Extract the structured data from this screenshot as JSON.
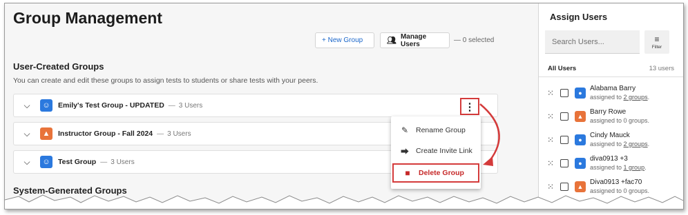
{
  "page": {
    "title": "Group Management",
    "new_group_label": "+ New Group",
    "manage_users_label": "Manage Users",
    "selected_text": "— 0 selected"
  },
  "user_groups": {
    "title": "User-Created Groups",
    "description": "You can create and edit these groups to assign tests to students or share tests with your peers.",
    "rows": [
      {
        "name": "Emily's Test Group - UPDATED",
        "count": "3 Users",
        "icon": "users-icon",
        "color": "#2b79de"
      },
      {
        "name": "Instructor Group - Fall 2024",
        "count": "3 Users",
        "icon": "graduation-cap-icon",
        "color": "#e8733a"
      },
      {
        "name": "Test Group",
        "count": "3 Users",
        "icon": "users-icon",
        "color": "#2b79de"
      }
    ]
  },
  "menu": {
    "items": [
      {
        "label": "Rename Group",
        "icon": "pencil-icon"
      },
      {
        "label": "Create Invite Link",
        "icon": "share-icon"
      },
      {
        "label": "Delete Group",
        "icon": "trash-icon",
        "color": "#c62828"
      }
    ]
  },
  "system_groups": {
    "title": "System-Generated Groups"
  },
  "assign": {
    "title": "Assign Users",
    "search_placeholder": "Search Users...",
    "filter_label": "Filter",
    "all_users_label": "All Users",
    "user_count": "13 users",
    "users": [
      {
        "name": "Alabama Barry",
        "prefix": "assigned to ",
        "link": "2 groups",
        "suffix": ".",
        "role": "student"
      },
      {
        "name": "Barry Rowe",
        "prefix": "assigned to 0 groups.",
        "link": "",
        "suffix": "",
        "role": "instructor"
      },
      {
        "name": "Cindy Mauck",
        "prefix": "assigned to ",
        "link": "2 groups",
        "suffix": ".",
        "role": "student"
      },
      {
        "name": "diva0913 +3",
        "prefix": "assigned to ",
        "link": "1 group",
        "suffix": ".",
        "role": "student"
      },
      {
        "name": "Diva0913 +fac70",
        "prefix": "assigned to 0 groups.",
        "link": "",
        "suffix": "",
        "role": "instructor"
      }
    ]
  },
  "colors": {
    "accent_blue": "#1a66c9",
    "highlight_red": "#d43a3a",
    "student_icon": "#2b79de",
    "instructor_icon": "#e8733a"
  }
}
